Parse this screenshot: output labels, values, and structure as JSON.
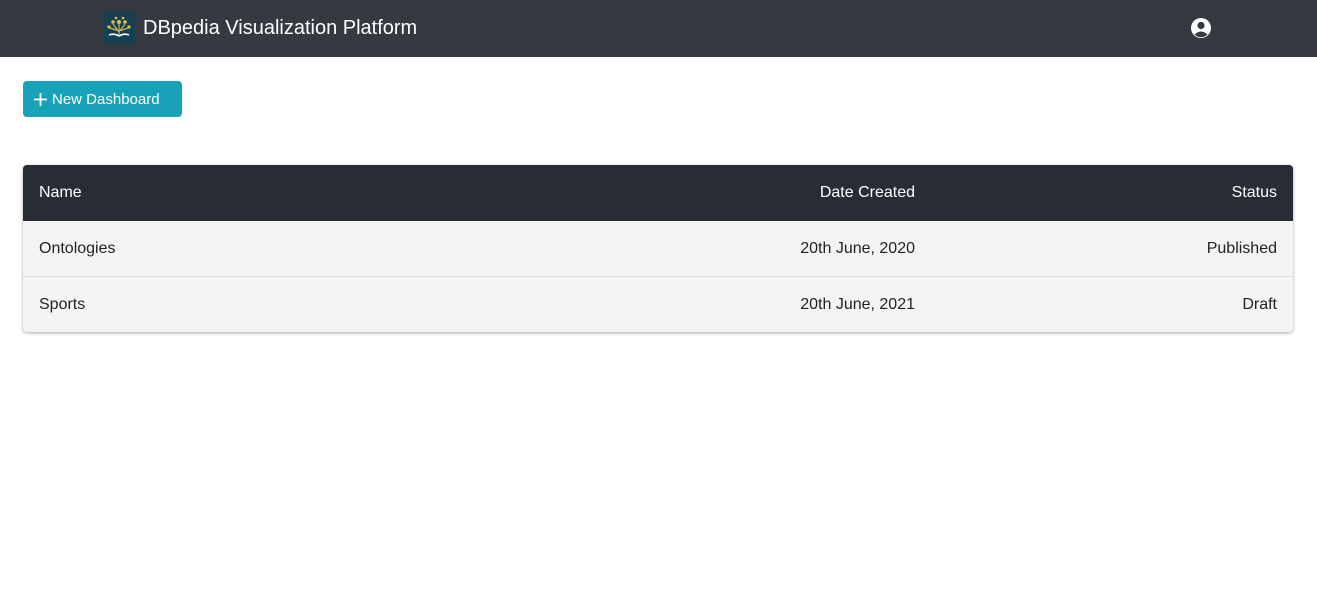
{
  "header": {
    "title": "DBpedia Visualization Platform",
    "logo_icon": "dbpedia-logo",
    "account_icon": "user-circle-icon",
    "background": "#343a40"
  },
  "toolbar": {
    "new_dashboard_label": "New Dashboard",
    "new_dashboard_icon": "plus-icon",
    "accent": "#17a2b8"
  },
  "table": {
    "columns": {
      "name": "Name",
      "date_created": "Date Created",
      "status": "Status"
    },
    "rows": [
      {
        "name": "Ontologies",
        "date_created": "20th June, 2020",
        "status": "Published"
      },
      {
        "name": "Sports",
        "date_created": "20th June, 2021",
        "status": "Draft"
      }
    ]
  }
}
